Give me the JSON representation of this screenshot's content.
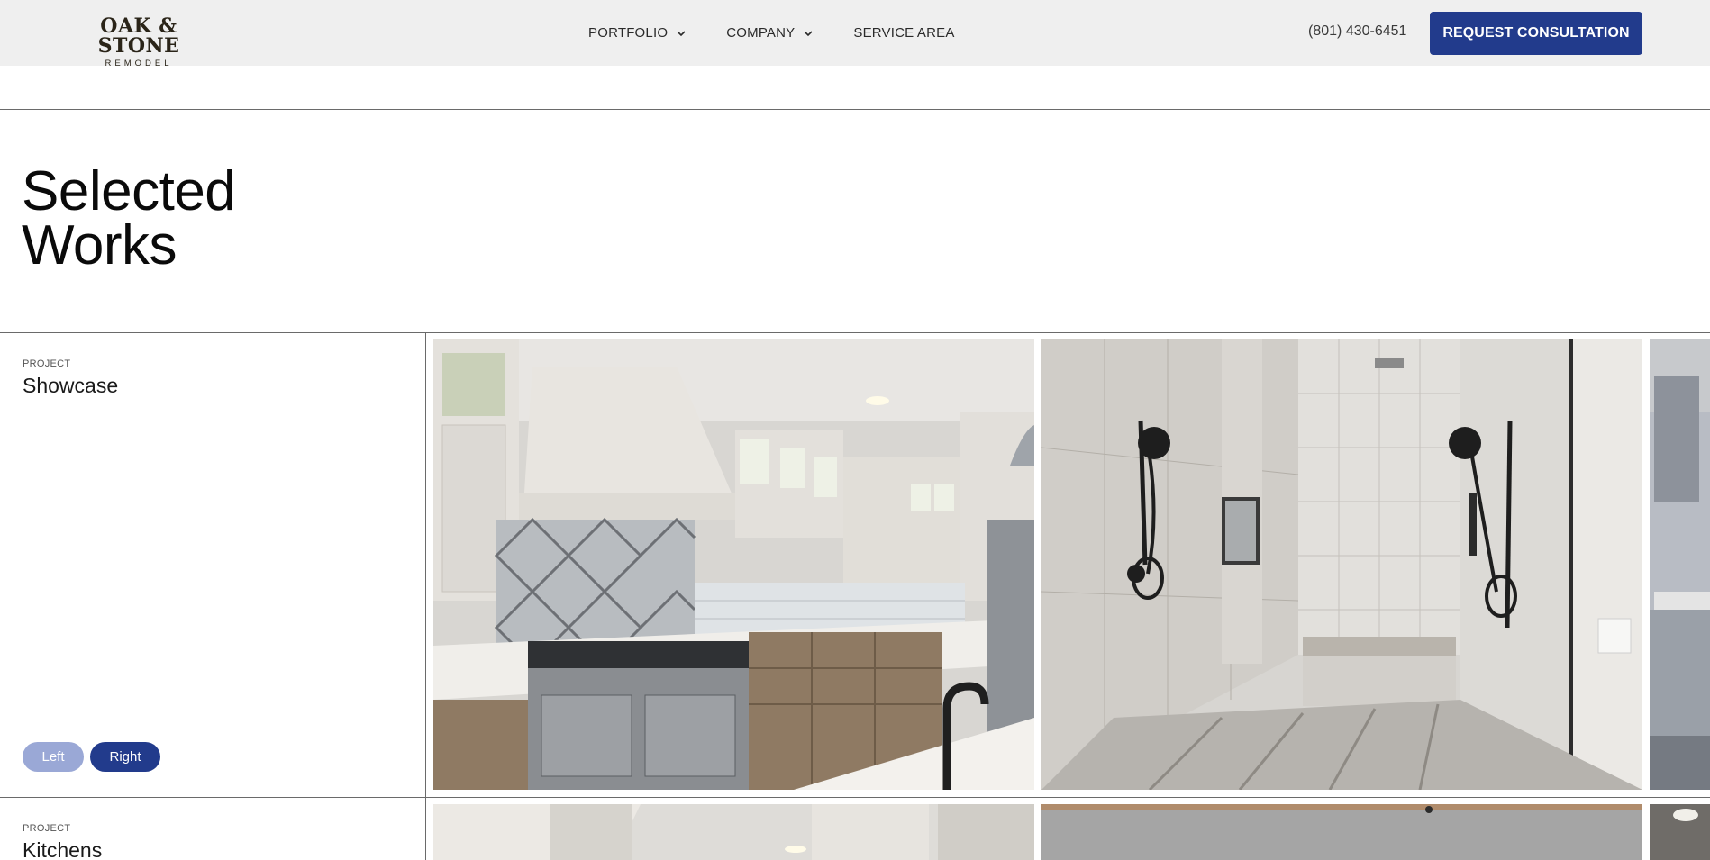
{
  "header": {
    "logo_main": "OAK & STONE",
    "logo_sub": "REMODEL",
    "nav": [
      {
        "label": "PORTFOLIO",
        "icon": "chevron-down-icon"
      },
      {
        "label": "COMPANY",
        "icon": "chevron-down-icon"
      },
      {
        "label": "SERVICE AREA"
      }
    ],
    "phone": "(801) 430-6451",
    "cta_label": "REQUEST CONSULTATION"
  },
  "hero": {
    "title_line1": "Selected",
    "title_line2": "Works"
  },
  "projects": [
    {
      "eyebrow": "PROJECT",
      "title": "Showcase",
      "controls": {
        "left_label": "Left",
        "right_label": "Right"
      }
    },
    {
      "eyebrow": "PROJECT",
      "title": "Kitchens"
    }
  ],
  "colors": {
    "header_bg": "#efefef",
    "accent": "#223b8c",
    "accent_light": "#9aa8d6"
  }
}
